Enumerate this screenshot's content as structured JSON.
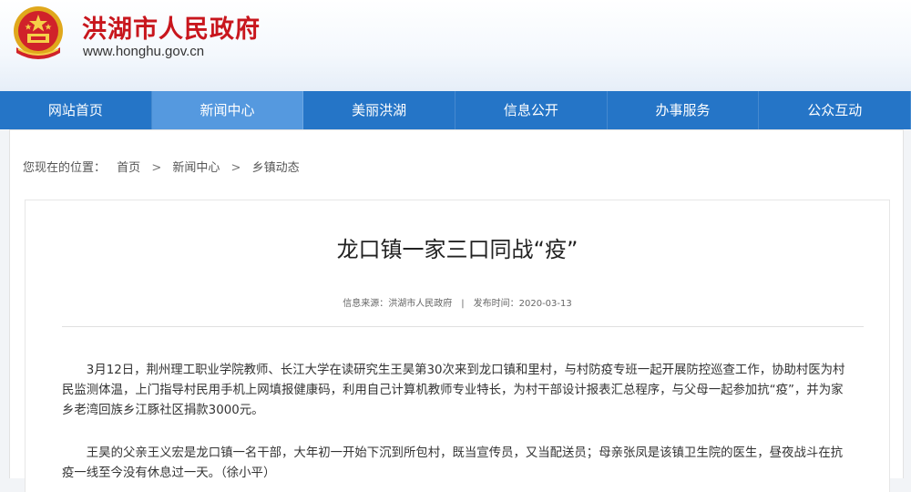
{
  "header": {
    "site_title": "洪湖市人民政府",
    "site_url": "www.honghu.gov.cn",
    "emblem_icon": "national-emblem-icon",
    "title_color": "#c8161d"
  },
  "nav": {
    "items": [
      {
        "label": "网站首页"
      },
      {
        "label": "新闻中心"
      },
      {
        "label": "美丽洪湖"
      },
      {
        "label": "信息公开"
      },
      {
        "label": "办事服务"
      },
      {
        "label": "公众互动"
      }
    ],
    "active": "新闻中心",
    "color": "#2575c7",
    "active_color": "#5599df"
  },
  "breadcrumb": {
    "prefix": "您现在的位置：",
    "items": [
      "首页",
      "新闻中心",
      "乡镇动态"
    ],
    "separator": ">"
  },
  "article": {
    "title": "龙口镇一家三口同战“疫”",
    "source": "信息来源：洪湖市人民政府",
    "divider": "|",
    "date": "发布时间：2020-03-13",
    "paragraphs": [
      "3月12日，荆州理工职业学院教师、长江大学在读研究生王昊第30次来到龙口镇和里村，与村防疫专班一起开展防控巡查工作，协助村医为村民监测体温，上门指导村民用手机上网填报健康码，利用自己计算机教师专业特长，为村干部设计报表汇总程序，与父母一起参加抗“疫”，并为家乡老湾回族乡江豚社区捐款3000元。",
      "王昊的父亲王义宏是龙口镇一名干部，大年初一开始下沉到所包村，既当宣传员，又当配送员；母亲张凤是该镇卫生院的医生，昼夜战斗在抗疫一线至今没有休息过一天。（徐小平）"
    ]
  }
}
